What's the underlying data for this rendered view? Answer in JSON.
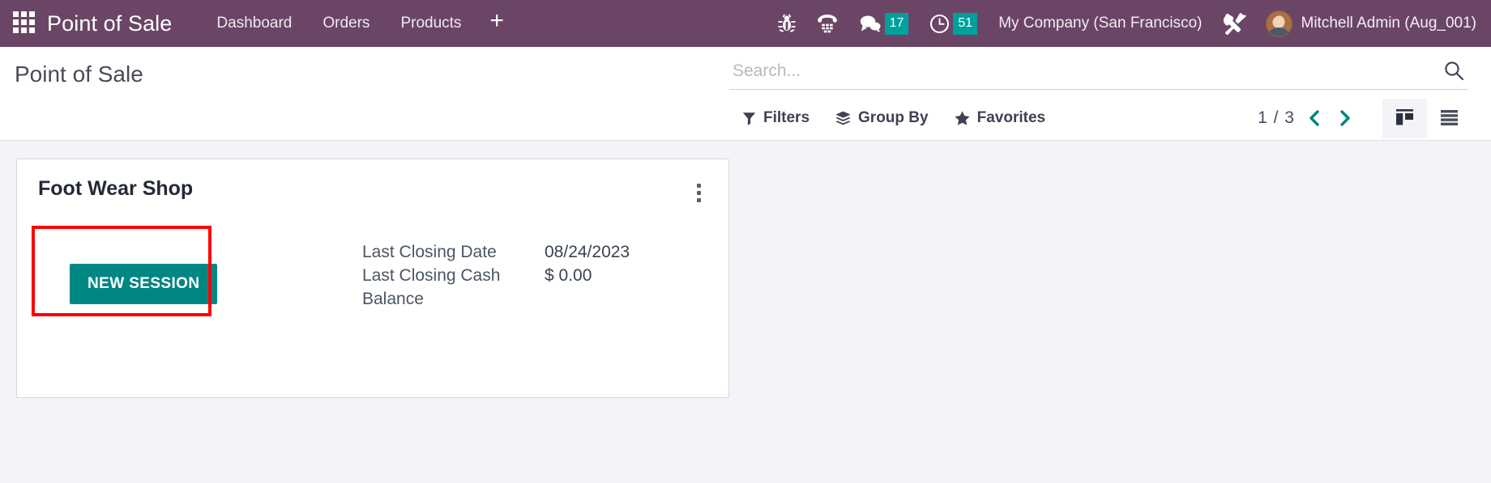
{
  "navbar": {
    "apps_icon": "apps-grid-icon",
    "brand": "Point of Sale",
    "menu": [
      {
        "label": "Dashboard"
      },
      {
        "label": "Orders"
      },
      {
        "label": "Products"
      }
    ],
    "plus_label": "+",
    "system_icons": [
      {
        "name": "bug-icon",
        "badge": null
      },
      {
        "name": "dialpad-phone-icon",
        "badge": null
      },
      {
        "name": "messages-icon",
        "badge": "17"
      },
      {
        "name": "activities-clock-icon",
        "badge": "51"
      }
    ],
    "company": "My Company (San Francisco)",
    "tools_icon": "wrench-screwdriver-icon",
    "user_name": "Mitchell Admin (Aug_001)",
    "badge_color": "#00a09d",
    "background_color": "#6b4566"
  },
  "control_panel": {
    "page_title": "Point of Sale",
    "search": {
      "placeholder": "Search...",
      "value": "",
      "icon": "search-icon"
    },
    "filter_buttons": [
      {
        "label": "Filters",
        "icon": "filter-funnel-icon"
      },
      {
        "label": "Group By",
        "icon": "layers-icon"
      },
      {
        "label": "Favorites",
        "icon": "star-icon"
      }
    ],
    "pager": {
      "count": "1 / 3",
      "previous_icon": "chevron-left-icon",
      "next_icon": "chevron-right-icon",
      "accent_color": "#00847e"
    },
    "view_switcher": [
      {
        "name": "kanban-view",
        "icon": "kanban-icon",
        "active": true
      },
      {
        "name": "list-view",
        "icon": "list-icon",
        "active": false
      }
    ]
  },
  "kanban": {
    "cards": [
      {
        "title": "Foot Wear Shop",
        "menu_icon": "kebab-menu-icon",
        "primary_action": "NEW SESSION",
        "primary_action_color": "#008784",
        "highlight_color": "#ff0000",
        "stats": [
          {
            "label": "Last Closing Date",
            "value": "08/24/2023"
          },
          {
            "label": "Last Closing Cash Balance",
            "value": "$ 0.00"
          }
        ]
      }
    ]
  }
}
